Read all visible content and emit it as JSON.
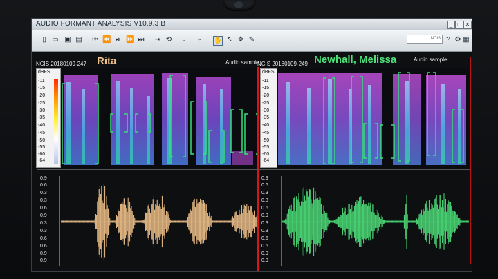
{
  "window": {
    "title": "AUDIO FORMANT ANALYSIS V10.9.3 B",
    "controls": [
      "_",
      "□",
      "✕"
    ],
    "search_text": "NCIS"
  },
  "toolbar": {
    "icons": [
      "new-icon",
      "open-icon",
      "save-icon",
      "print-icon",
      "skip-back-icon",
      "rewind-icon",
      "play-pause-icon",
      "fast-forward-icon",
      "skip-forward-icon",
      "step-icon",
      "loop-icon",
      "marker-icon",
      "marker2-icon",
      "hand-icon",
      "pointer-icon",
      "move-icon",
      "pen-icon"
    ]
  },
  "left": {
    "speaker": "Rita",
    "sample_id": "NCIS 20180109-247",
    "sample_tag": "Audio sample",
    "color": "#f2c38b",
    "dbfs_label": "dBFS",
    "dbfs_ticks": [
      "-11",
      "-15",
      "-20",
      "-25",
      "-30",
      "-35",
      "-40",
      "-45",
      "-50",
      "-55",
      "-60",
      "-64"
    ],
    "amp_ticks": [
      "0.9",
      "0.6",
      "0.3",
      "0.3",
      "0.6",
      "0.9",
      "0.3",
      "0.3",
      "0.6",
      "0.6",
      "0.9",
      "0.9"
    ]
  },
  "right": {
    "speaker": "Newhall, Melissa",
    "sample_id": "NCIS 20180109-249",
    "sample_tag": "Audio sample",
    "color": "#4de07a",
    "dbfs_label": "dBFS",
    "dbfs_ticks": [
      "-11",
      "-15",
      "-20",
      "-25",
      "-30",
      "-35",
      "-40",
      "-45",
      "-50",
      "-55",
      "-60",
      "-64"
    ],
    "amp_ticks": [
      "0.9",
      "0.6",
      "0.3",
      "0.3",
      "0.6",
      "0.9",
      "0.3",
      "0.3",
      "0.6",
      "0.6",
      "0.9",
      "0.9"
    ]
  }
}
